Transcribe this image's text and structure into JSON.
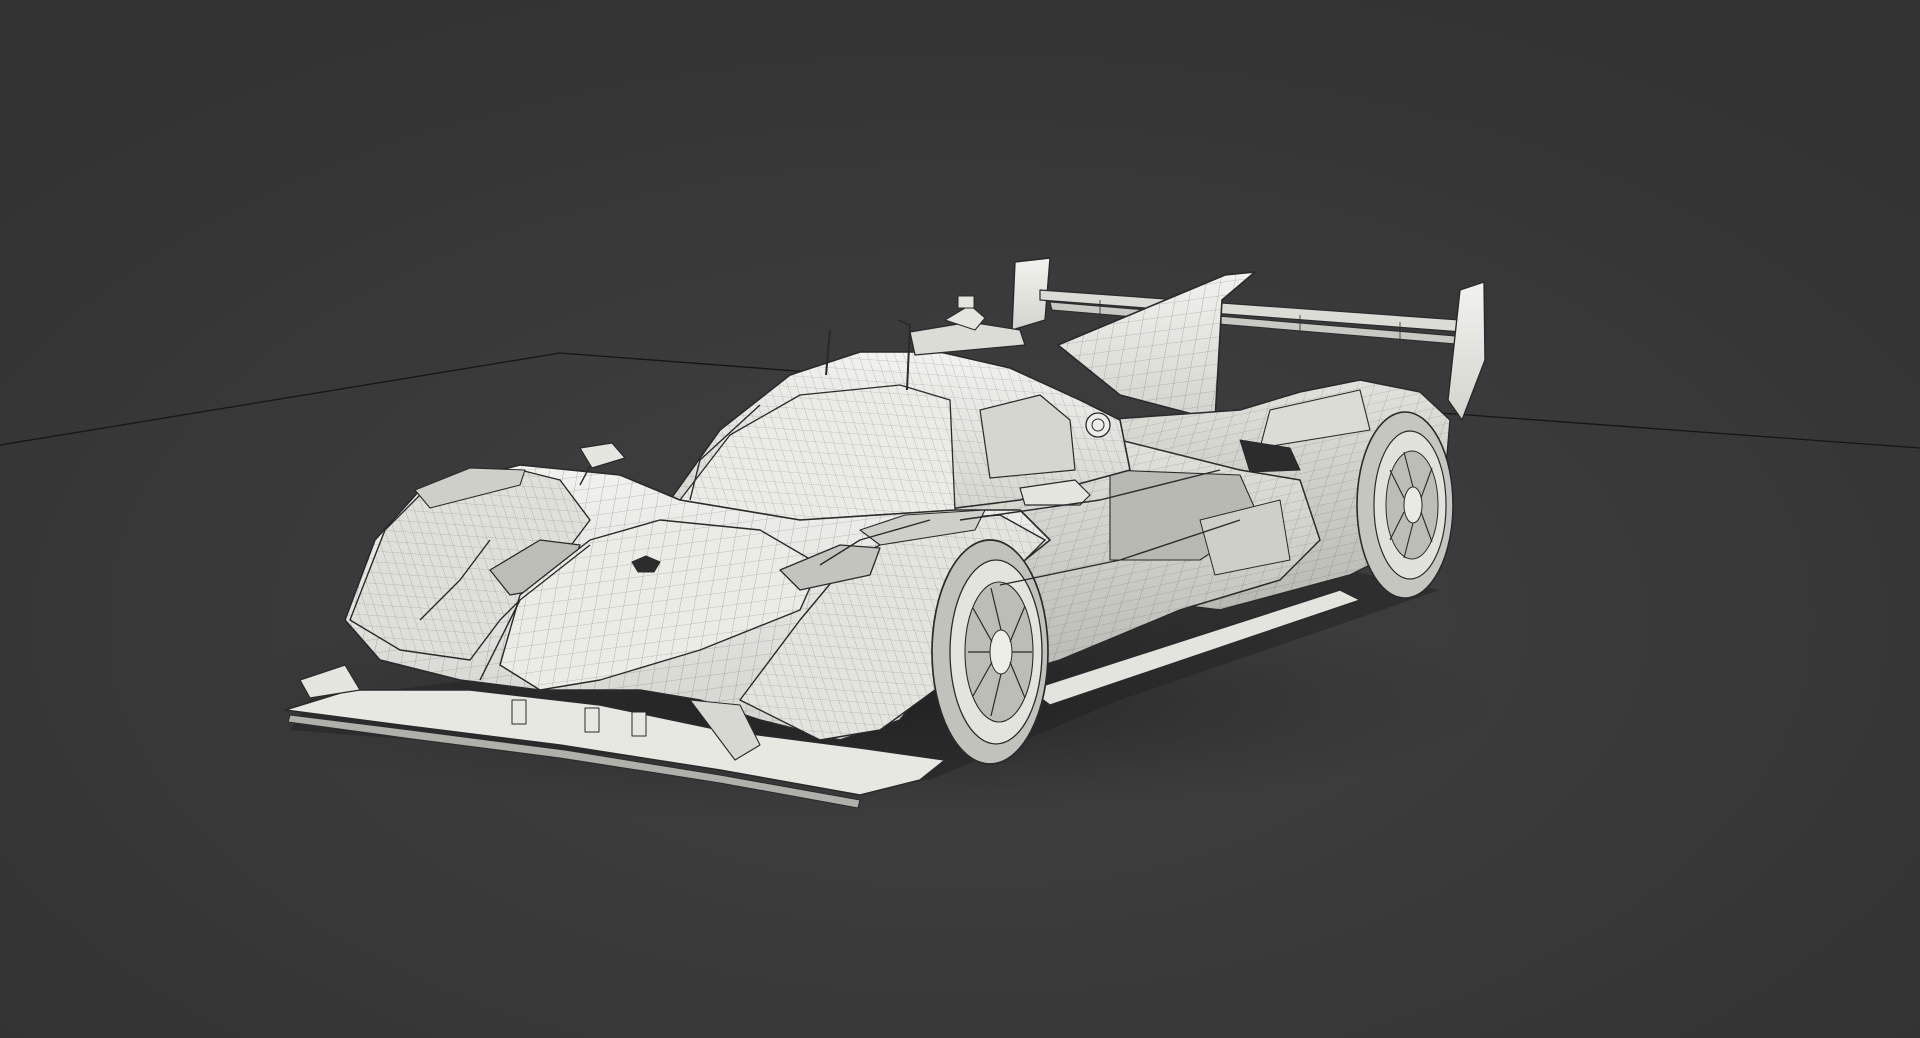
{
  "scene": {
    "subject": "race-car-wireframe",
    "background_color": "#3a3a3a",
    "floor_color": "#383838",
    "shadow_color": "#2a2a2a",
    "body_fill": "#e9e9e4",
    "body_shade": "#c8c8c2",
    "body_dark": "#9a9a94",
    "wire_color": "#2d2d2d",
    "floor_line_color": "#1c1c1c"
  }
}
